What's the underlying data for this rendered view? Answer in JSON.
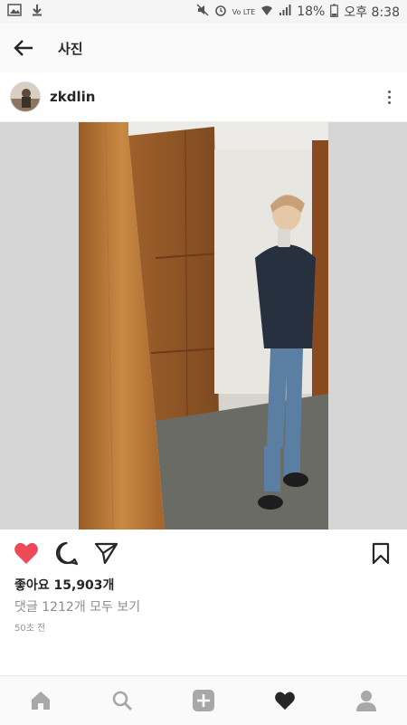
{
  "status_bar": {
    "battery": "18%",
    "time": "오후 8:38",
    "network": "Vo LTE"
  },
  "header": {
    "title": "사진"
  },
  "post": {
    "username": "zkdlin",
    "likes_text": "좋아요 15,903개",
    "comments_text": "댓글 1212개 모두 보기",
    "timestamp": "50초 전"
  },
  "colors": {
    "like_red": "#ed4956",
    "icon_dark": "#262626",
    "nav_gray": "#a8a8a8"
  },
  "icons": {
    "back": "arrow-left",
    "more": "vertical-dots",
    "like": "heart-filled",
    "comment": "speech-bubble",
    "share": "paper-plane",
    "save": "bookmark",
    "nav": [
      "home",
      "search",
      "add",
      "activity-heart",
      "profile"
    ]
  }
}
